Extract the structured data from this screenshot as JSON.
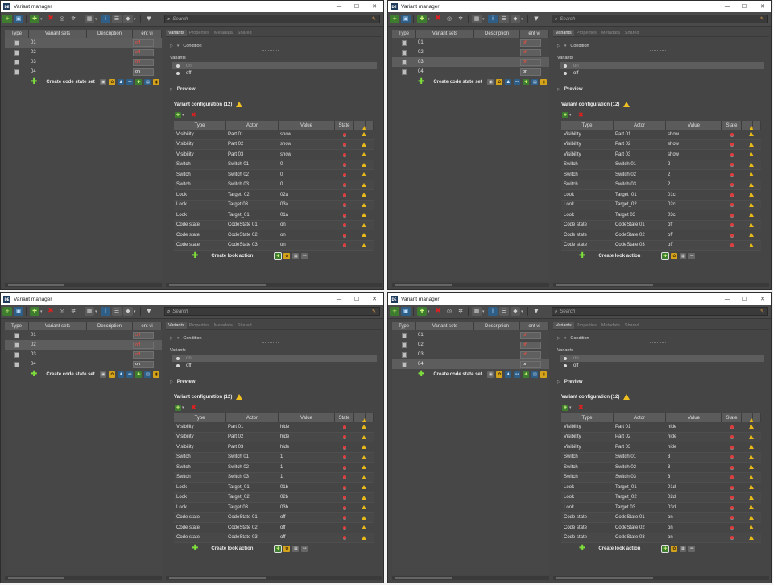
{
  "app": {
    "title": "Variant manager",
    "icon_text": "DE",
    "window_controls": {
      "minimize": "—",
      "maximize": "☐",
      "close": "✕"
    },
    "search_placeholder": "Search",
    "tabs": [
      "Variants",
      "Properties",
      "Metadata",
      "Shared"
    ],
    "left_headers": {
      "type": "Type",
      "name": "Variant sets",
      "description": "Description",
      "state": "ent vi"
    },
    "create_code_state_set": "Create code state set",
    "condition_label": "Condition",
    "variants_label": "Variants",
    "preview_label": "Preview",
    "variant_config_label": "Variant configuration (12)",
    "grid_headers": {
      "type": "Type",
      "actor": "Actor",
      "value": "Value",
      "state": "State"
    },
    "create_look_action": "Create look action",
    "variant_options": [
      "on",
      "off"
    ],
    "colors": {
      "background": "#454545",
      "accent_green": "#7fe03b",
      "error_red": "#e02020",
      "warning_yellow": "#f0c020",
      "state_off": "#ff4d3d"
    }
  },
  "windows": [
    {
      "id": "top-left",
      "selected_variant_set": 0,
      "variant_sets": [
        {
          "name": "01",
          "state": "off"
        },
        {
          "name": "02",
          "state": "off"
        },
        {
          "name": "03",
          "state": "off"
        },
        {
          "name": "04",
          "state": "on"
        }
      ],
      "selected_variant": 0,
      "config": [
        {
          "type": "Visibility",
          "actor": "Part 01",
          "value": "show"
        },
        {
          "type": "Visibility",
          "actor": "Part 02",
          "value": "show"
        },
        {
          "type": "Visibility",
          "actor": "Part 03",
          "value": "show"
        },
        {
          "type": "Switch",
          "actor": "Switch 01",
          "value": "0"
        },
        {
          "type": "Switch",
          "actor": "Switch 02",
          "value": "0"
        },
        {
          "type": "Switch",
          "actor": "Switch 03",
          "value": "0"
        },
        {
          "type": "Look",
          "actor": "Target_02",
          "value": "02a"
        },
        {
          "type": "Look",
          "actor": "Target 03",
          "value": "03a"
        },
        {
          "type": "Look",
          "actor": "Target_01",
          "value": "01a"
        },
        {
          "type": "Code state",
          "actor": "CodeState 01",
          "value": "on"
        },
        {
          "type": "Code state",
          "actor": "CodeState 02",
          "value": "on"
        },
        {
          "type": "Code state",
          "actor": "CodeState 03",
          "value": "on"
        }
      ]
    },
    {
      "id": "top-right",
      "selected_variant_set": 2,
      "variant_sets": [
        {
          "name": "01",
          "state": "off"
        },
        {
          "name": "02",
          "state": "off"
        },
        {
          "name": "03",
          "state": "off"
        },
        {
          "name": "04",
          "state": "on"
        }
      ],
      "selected_variant": 0,
      "config": [
        {
          "type": "Visibility",
          "actor": "Part 01",
          "value": "show"
        },
        {
          "type": "Visibility",
          "actor": "Part 02",
          "value": "show"
        },
        {
          "type": "Visibility",
          "actor": "Part 03",
          "value": "show"
        },
        {
          "type": "Switch",
          "actor": "Switch 01",
          "value": "2"
        },
        {
          "type": "Switch",
          "actor": "Switch 02",
          "value": "2"
        },
        {
          "type": "Switch",
          "actor": "Switch 03",
          "value": "2"
        },
        {
          "type": "Look",
          "actor": "Target_01",
          "value": "01c"
        },
        {
          "type": "Look",
          "actor": "Target_02",
          "value": "02c"
        },
        {
          "type": "Look",
          "actor": "Target 03",
          "value": "03c"
        },
        {
          "type": "Code state",
          "actor": "CodeState 01",
          "value": "off"
        },
        {
          "type": "Code state",
          "actor": "CodeState 02",
          "value": "off"
        },
        {
          "type": "Code state",
          "actor": "CodeState 03",
          "value": "off"
        }
      ]
    },
    {
      "id": "bottom-left",
      "selected_variant_set": 1,
      "variant_sets": [
        {
          "name": "01",
          "state": "off"
        },
        {
          "name": "02",
          "state": "off"
        },
        {
          "name": "03",
          "state": "off"
        },
        {
          "name": "04",
          "state": "on"
        }
      ],
      "selected_variant": 0,
      "config": [
        {
          "type": "Visibility",
          "actor": "Part 01",
          "value": "hide"
        },
        {
          "type": "Visibility",
          "actor": "Part 02",
          "value": "hide"
        },
        {
          "type": "Visibility",
          "actor": "Part 03",
          "value": "hide"
        },
        {
          "type": "Switch",
          "actor": "Switch 01",
          "value": "1"
        },
        {
          "type": "Switch",
          "actor": "Switch 02",
          "value": "1"
        },
        {
          "type": "Switch",
          "actor": "Switch 03",
          "value": "1"
        },
        {
          "type": "Look",
          "actor": "Target_01",
          "value": "01b"
        },
        {
          "type": "Look",
          "actor": "Target_02",
          "value": "02b"
        },
        {
          "type": "Look",
          "actor": "Target 03",
          "value": "03b"
        },
        {
          "type": "Code state",
          "actor": "CodeState 01",
          "value": "off"
        },
        {
          "type": "Code state",
          "actor": "CodeState 02",
          "value": "off"
        },
        {
          "type": "Code state",
          "actor": "CodeState 03",
          "value": "off"
        }
      ]
    },
    {
      "id": "bottom-right",
      "selected_variant_set": 3,
      "variant_sets": [
        {
          "name": "01",
          "state": "off"
        },
        {
          "name": "02",
          "state": "off"
        },
        {
          "name": "03",
          "state": "off"
        },
        {
          "name": "04",
          "state": "on"
        }
      ],
      "selected_variant": 0,
      "config": [
        {
          "type": "Visibility",
          "actor": "Part 01",
          "value": "hide"
        },
        {
          "type": "Visibility",
          "actor": "Part 02",
          "value": "hide"
        },
        {
          "type": "Visibility",
          "actor": "Part 03",
          "value": "hide"
        },
        {
          "type": "Switch",
          "actor": "Switch 01",
          "value": "3"
        },
        {
          "type": "Switch",
          "actor": "Switch 02",
          "value": "3"
        },
        {
          "type": "Switch",
          "actor": "Switch 03",
          "value": "3"
        },
        {
          "type": "Look",
          "actor": "Target_01",
          "value": "01d"
        },
        {
          "type": "Look",
          "actor": "Target_02",
          "value": "02d"
        },
        {
          "type": "Look",
          "actor": "Target 03",
          "value": "03d"
        },
        {
          "type": "Code state",
          "actor": "CodeState 01",
          "value": "on"
        },
        {
          "type": "Code state",
          "actor": "CodeState 02",
          "value": "on"
        },
        {
          "type": "Code state",
          "actor": "CodeState 03",
          "value": "on"
        }
      ]
    }
  ]
}
